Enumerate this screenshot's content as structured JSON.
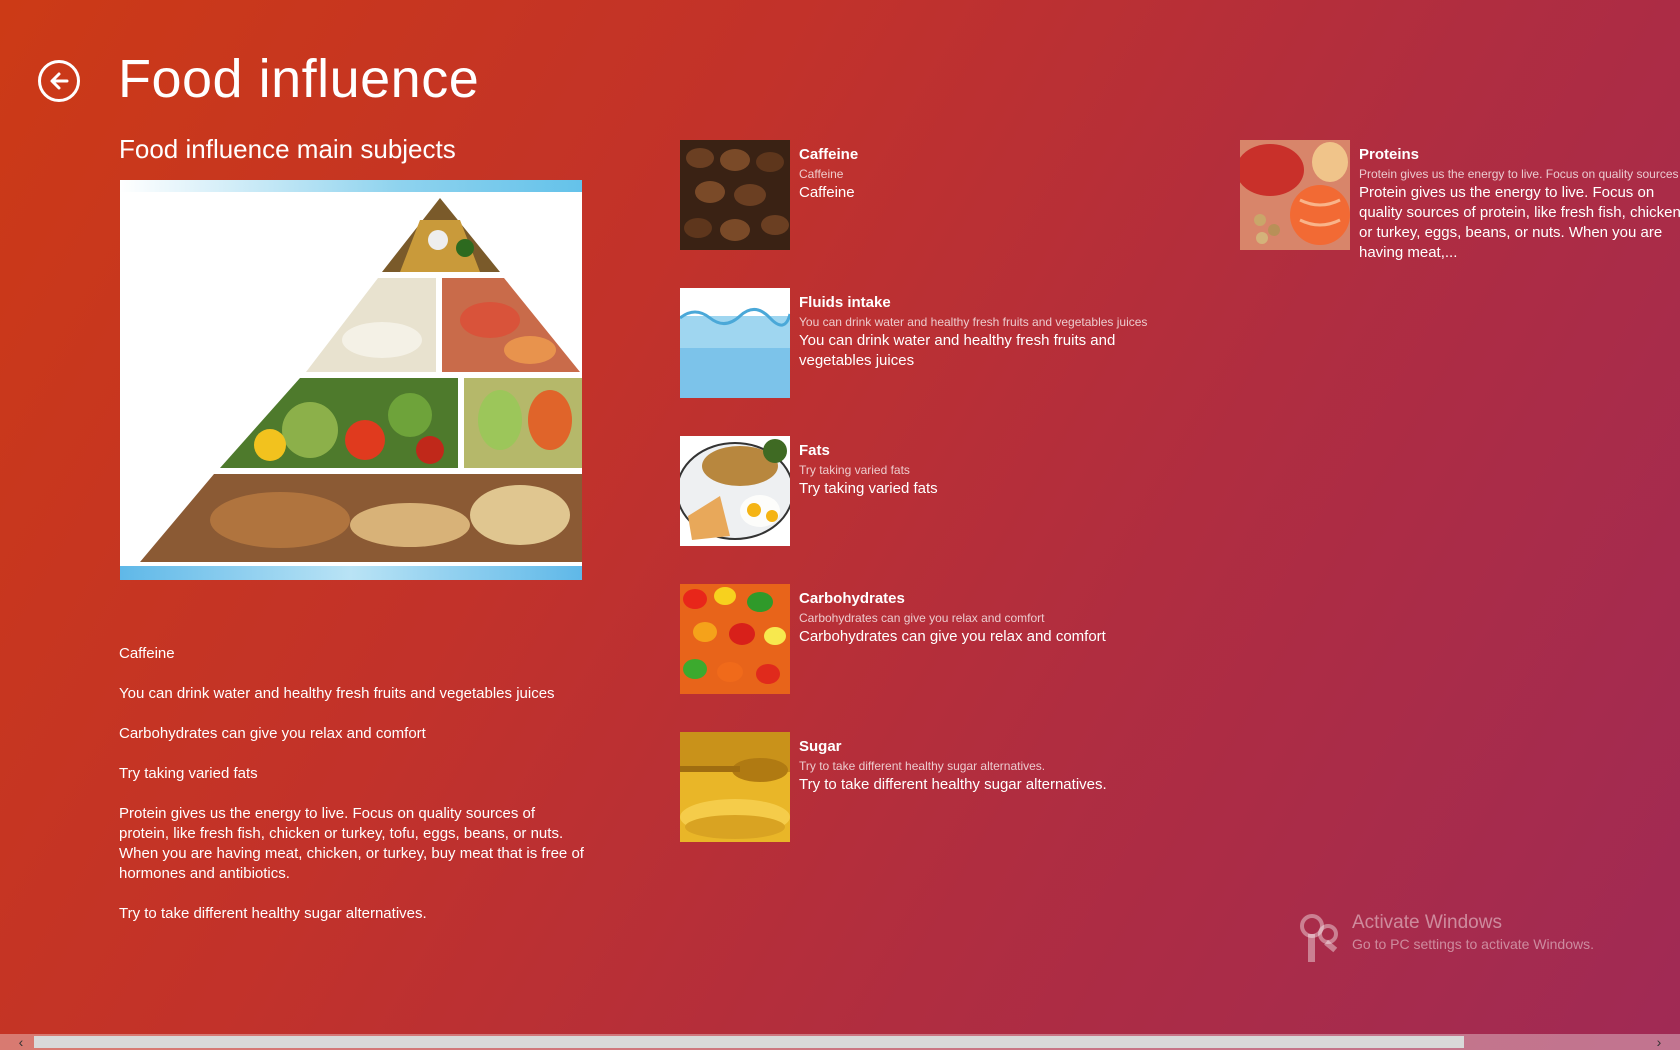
{
  "header": {
    "title": "Food influence",
    "back_label": "Back"
  },
  "section": {
    "title": "Food influence main subjects"
  },
  "descriptions": [
    "Caffeine",
    "You can drink water and healthy fresh fruits and vegetables juices",
    "Carbohydrates can give you relax and comfort",
    "Try taking varied fats",
    "Protein gives us the energy to live. Focus on quality sources of protein, like fresh fish, chicken or turkey, tofu, eggs, beans, or nuts. When you are having meat, chicken, or turkey, buy meat that is free of hormones and antibiotics.",
    "Try to take different healthy sugar alternatives."
  ],
  "tiles": [
    {
      "title": "Caffeine",
      "subtitle": "Caffeine",
      "description": "Caffeine",
      "icon": "coffee-beans-image"
    },
    {
      "title": "Fluids intake",
      "subtitle": "You can drink water and healthy fresh fruits and vegetables juices",
      "description": "You can drink water and healthy fresh fruits and vegetables juices",
      "icon": "water-image"
    },
    {
      "title": "Fats",
      "subtitle": "Try taking varied fats",
      "description": "Try taking varied fats",
      "icon": "breakfast-plate-image"
    },
    {
      "title": "Carbohydrates",
      "subtitle": "Carbohydrates can give you relax and comfort",
      "description": "Carbohydrates can give you relax and comfort",
      "icon": "gummy-bears-image"
    },
    {
      "title": "Sugar",
      "subtitle": "Try to take different healthy sugar alternatives.",
      "description": "Try to take different healthy sugar alternatives.",
      "icon": "honey-spoon-image"
    },
    {
      "title": "Proteins",
      "subtitle": "Protein gives us the energy to live. Focus on quality sources of protein, like fresh fish, chicken or turkey, tofu, eggs, beans, or nuts.",
      "description": "Protein gives us the energy to live. Focus on quality sources of protein, like fresh fish, chicken or turkey, eggs, beans, or nuts. When you are having meat,...",
      "icon": "meat-fish-image"
    }
  ],
  "watermark": {
    "title": "Activate Windows",
    "subtitle": "Go to PC settings to activate Windows."
  },
  "scrollbar": {
    "left_arrow": "‹",
    "right_arrow": "›"
  },
  "colors": {
    "background_start": "#cc3a16",
    "background_end": "#a02a55",
    "text": "#ffffff"
  }
}
